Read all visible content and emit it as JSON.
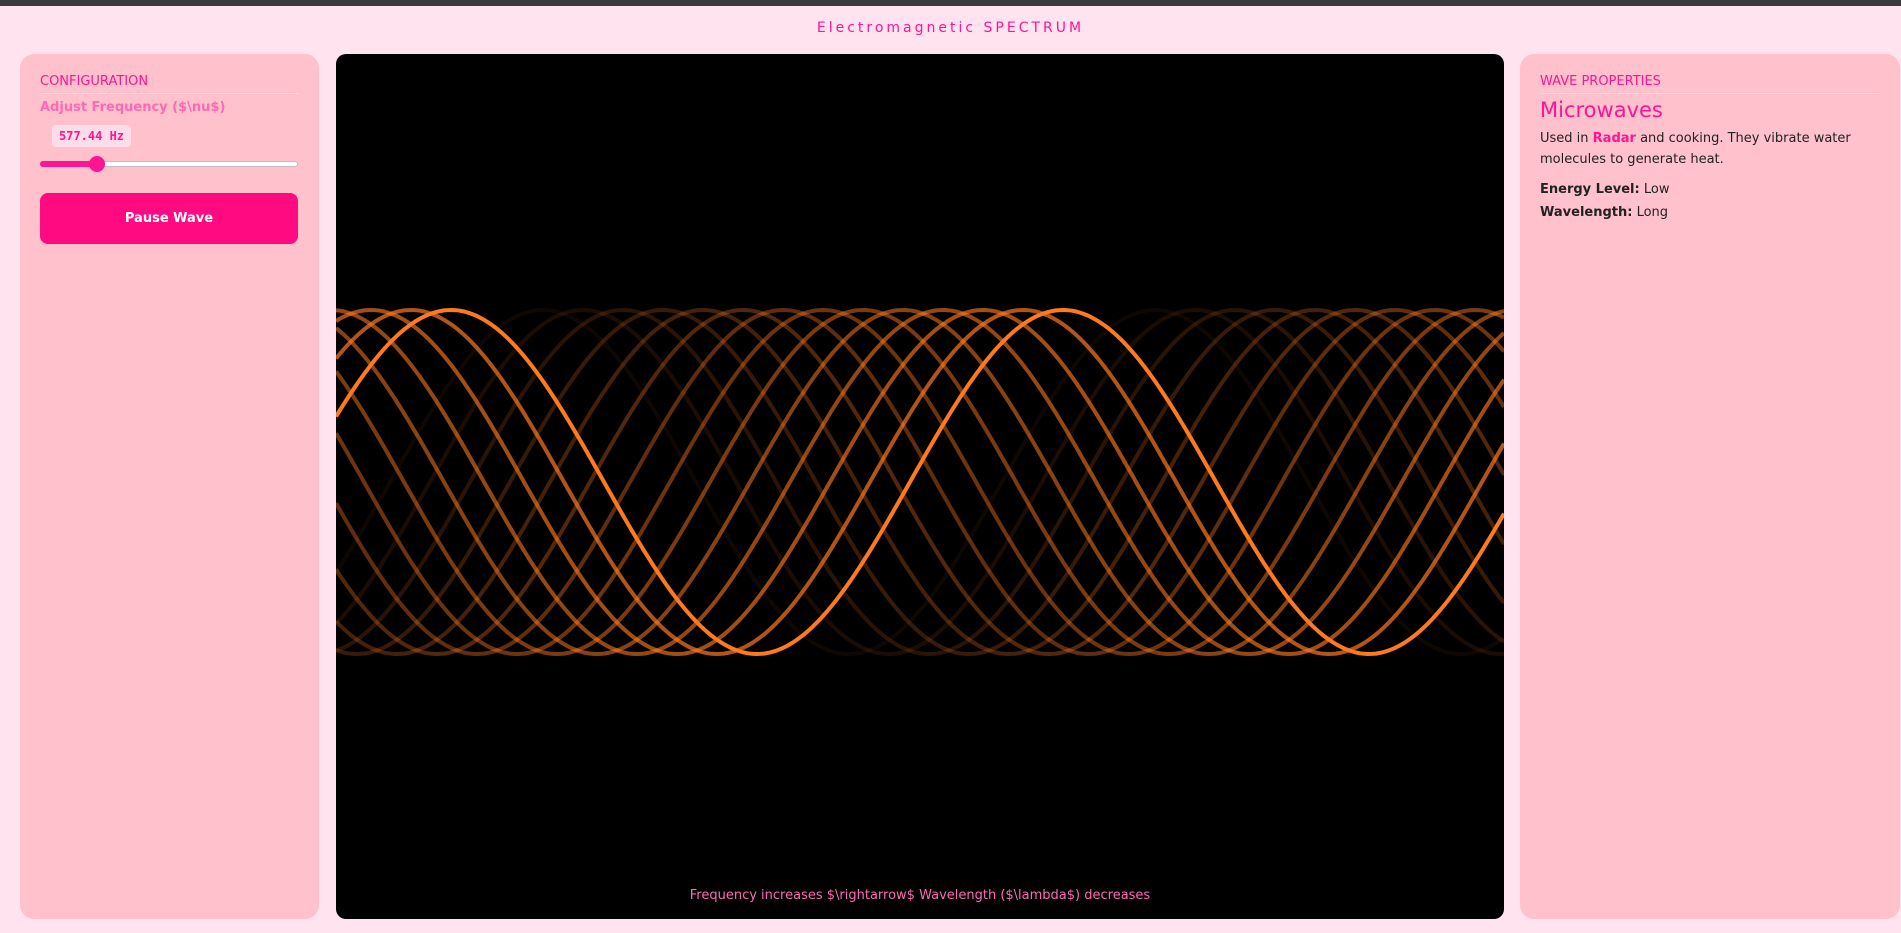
{
  "app": {
    "title": "Electromagnetic SPECTRUM"
  },
  "config": {
    "heading": "CONFIGURATION",
    "freq_label": "Adjust Frequency ($\\nu$)",
    "freq_value": "577.44 Hz",
    "slider_fraction": 0.22,
    "pause_label": "Pause Wave"
  },
  "canvas": {
    "caption": "Frequency increases $\\rightarrow$ Wavelength ($\\lambda$) decreases",
    "wave_color": "#ff7a1f",
    "background": "#000000"
  },
  "properties": {
    "heading": "WAVE PROPERTIES",
    "name": "Microwaves",
    "desc_prefix": "Used in ",
    "desc_highlight": "Radar",
    "desc_suffix": " and cooking. They vibrate water molecules to generate heat.",
    "energy_key": "Energy Level:",
    "energy_value": "Low",
    "wavelength_key": "Wavelength:",
    "wavelength_value": "Long"
  },
  "colors": {
    "accent": "#ff1493",
    "panel": "#ffc1cc",
    "page": "#ffe4ef"
  }
}
